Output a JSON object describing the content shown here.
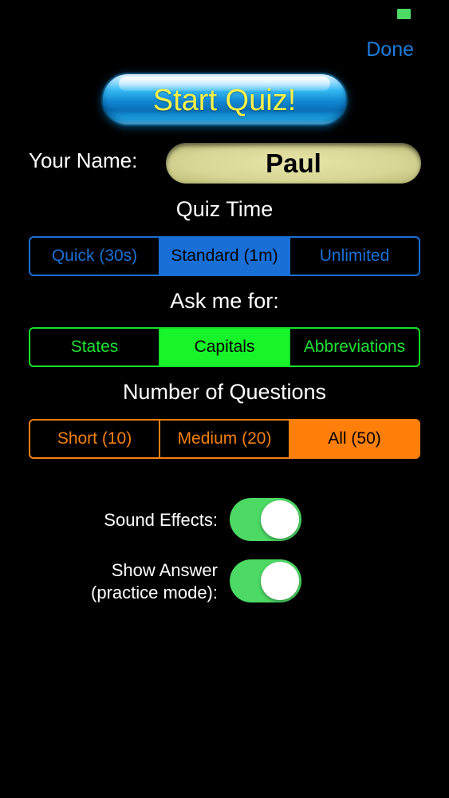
{
  "header": {
    "done_label": "Done"
  },
  "start_button": {
    "label": "Start Quiz!"
  },
  "name": {
    "label": "Your Name:",
    "value": "Paul"
  },
  "quiz_time": {
    "title": "Quiz Time",
    "options": [
      "Quick (30s)",
      "Standard (1m)",
      "Unlimited"
    ],
    "selected": "Standard (1m)",
    "color": "#1a6fd6"
  },
  "ask_for": {
    "title": "Ask me for:",
    "options": [
      "States",
      "Capitals",
      "Abbreviations"
    ],
    "selected": "Capitals",
    "color": "#17e02a"
  },
  "num_questions": {
    "title": "Number of Questions",
    "options": [
      "Short (10)",
      "Medium (20)",
      "All (50)"
    ],
    "selected": "All (50)",
    "color": "#ff7f0a"
  },
  "settings": {
    "sound_effects": {
      "label": "Sound Effects:",
      "on": true
    },
    "show_answer": {
      "label_line1": "Show Answer",
      "label_line2": "(practice mode):",
      "on": true
    },
    "toggle_on_color": "#4cd964"
  },
  "status_bar": {
    "battery_color": "#4cd964"
  }
}
